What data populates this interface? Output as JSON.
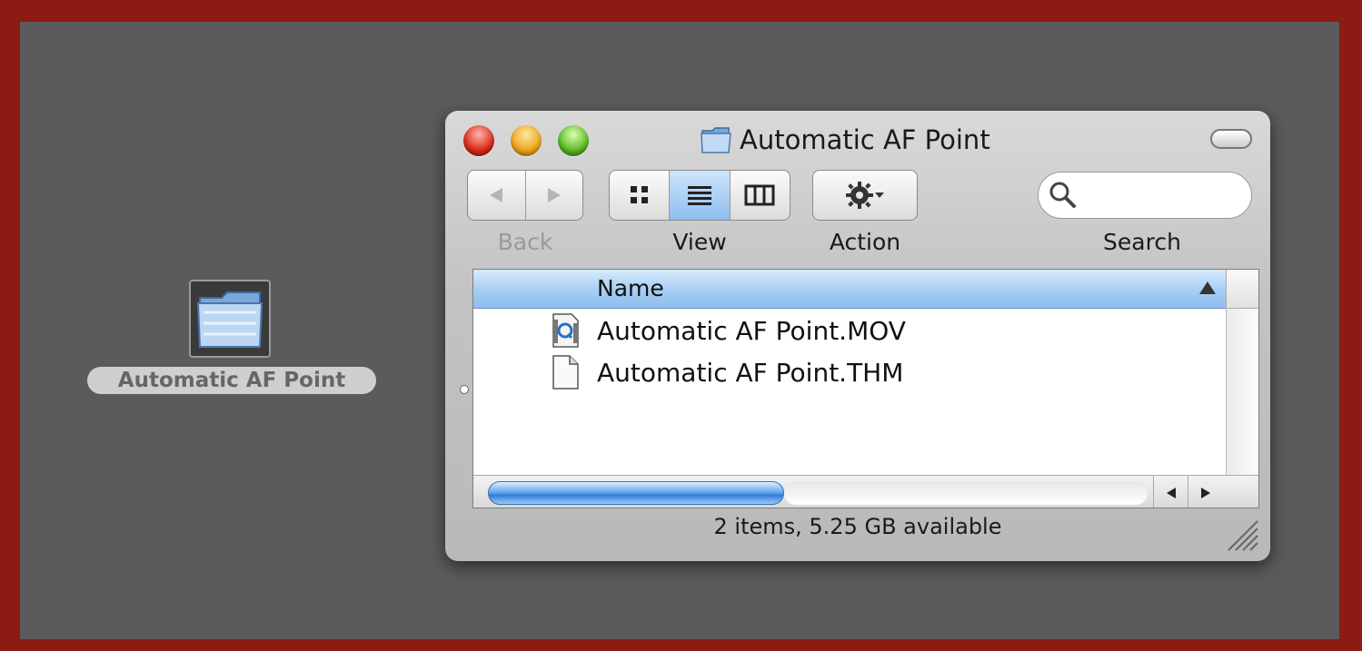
{
  "desktop": {
    "folder_label": "Automatic AF Point"
  },
  "window": {
    "title": "Automatic AF Point",
    "toolbar": {
      "back_label": "Back",
      "view_label": "View",
      "action_label": "Action",
      "search_label": "Search",
      "search_placeholder": ""
    },
    "list": {
      "column_header": "Name",
      "items": [
        {
          "name": "Automatic AF Point.MOV",
          "icon": "quicktime-movie-icon"
        },
        {
          "name": "Automatic AF Point.THM",
          "icon": "document-icon"
        }
      ]
    },
    "status": "2 items, 5.25 GB available"
  },
  "colors": {
    "frame": "#8e1a14",
    "desktop": "#5b5b5b",
    "selection_blue": "#8dbdee"
  }
}
